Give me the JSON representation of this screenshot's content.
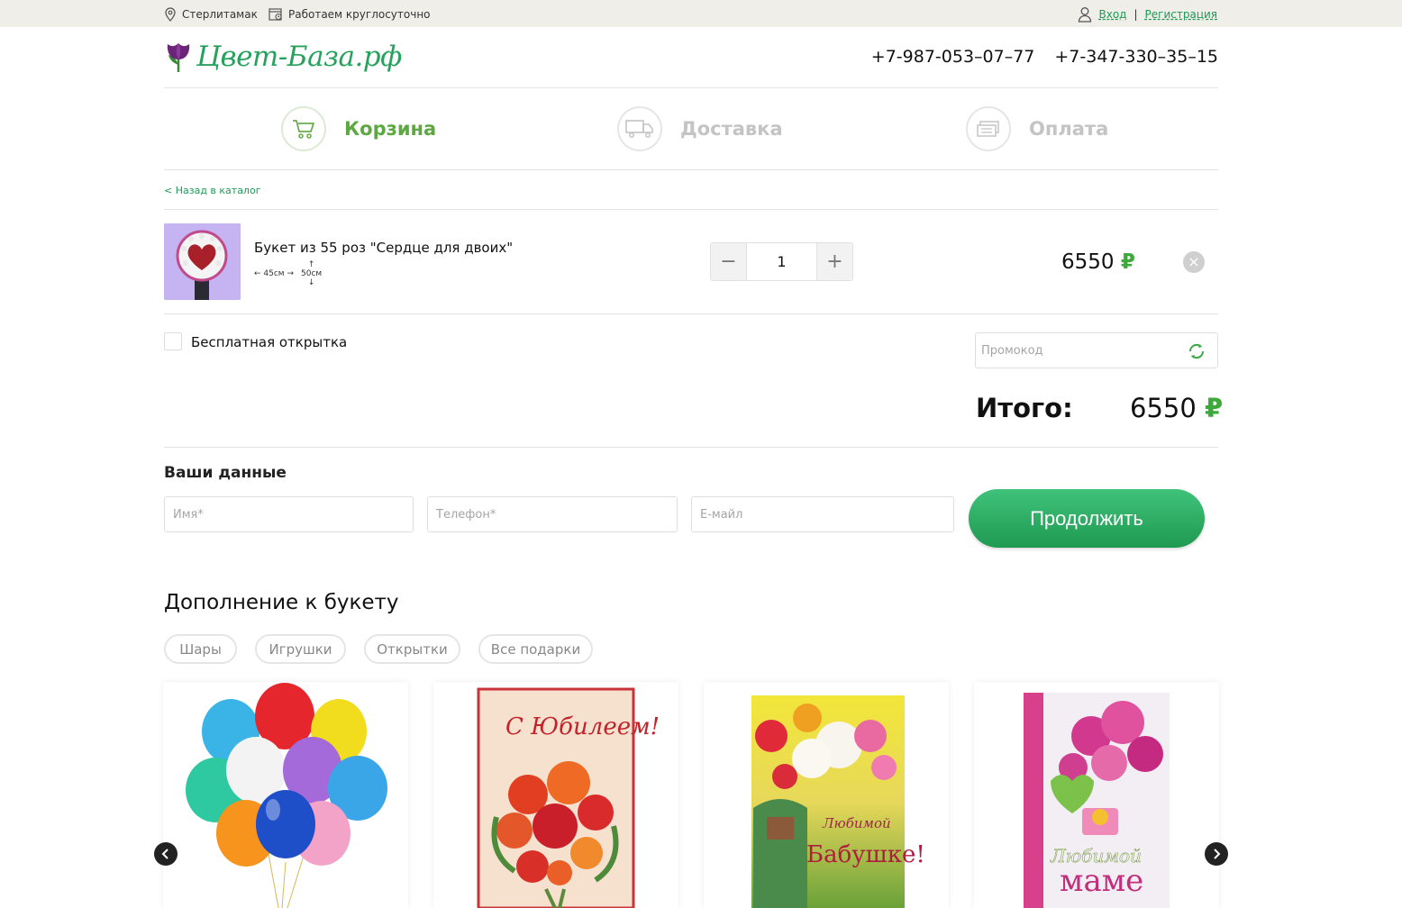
{
  "topbar": {
    "city": "Стерлитамак",
    "hours": "Работаем круглосуточно",
    "login": "Вход",
    "separator": "|",
    "register": "Регистрация"
  },
  "header": {
    "logo_text": "Цвет-База.рф",
    "phones": [
      "+7-987-053–07–77",
      "+7-347-330–35–15"
    ]
  },
  "steps": [
    {
      "label": "Корзина",
      "icon": "cart-icon",
      "active": true
    },
    {
      "label": "Доставка",
      "icon": "truck-icon",
      "active": false
    },
    {
      "label": "Оплата",
      "icon": "money-icon",
      "active": false
    }
  ],
  "back_link": "< Назад в каталог",
  "cart_item": {
    "name": "Букет из 55 роз \"Сердце для двоих\"",
    "width_label": "45см",
    "height_label": "50см",
    "quantity": "1",
    "minus": "−",
    "plus": "+",
    "price": "6550",
    "currency": "₽",
    "remove": "×"
  },
  "free_card_label": "Бесплатная открытка",
  "promo": {
    "placeholder": "Промокод"
  },
  "total": {
    "label": "Итого:",
    "value": "6550",
    "currency": "₽"
  },
  "customer": {
    "title": "Ваши данные",
    "name_placeholder": "Имя*",
    "phone_placeholder": "Телефон*",
    "email_placeholder": "E-майл",
    "continue_label": "Продолжить"
  },
  "addons": {
    "title": "Дополнение к букету",
    "filters": [
      "Шары",
      "Игрушки",
      "Открытки",
      "Все подарки"
    ],
    "cards": [
      {
        "image": "balloons"
      },
      {
        "image": "card-jubilee",
        "text": "С Юбилеем!"
      },
      {
        "image": "card-grandma",
        "text1": "Любимой",
        "text2": "Бабушке!"
      },
      {
        "image": "card-mom",
        "text1": "Любимой",
        "text2": "маме"
      }
    ]
  },
  "colors": {
    "brand": "#27a25e",
    "step_active": "#5ea843",
    "accent_button": "#2aae62"
  }
}
